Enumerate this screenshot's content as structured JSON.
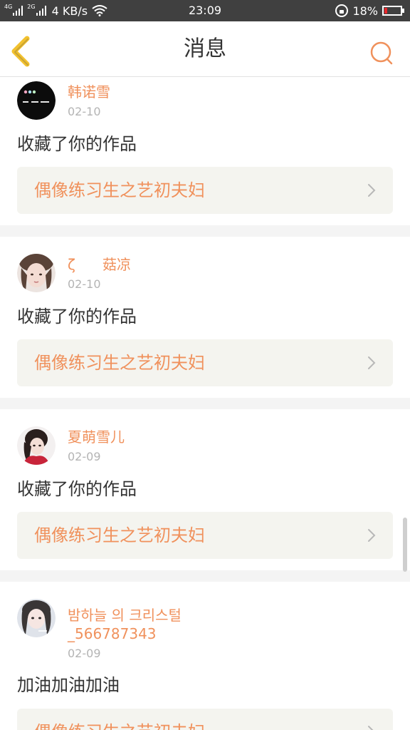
{
  "status_bar": {
    "network_tag_1": "4G",
    "network_tag_2": "2G",
    "speed": "4 KB/s",
    "time": "23:09",
    "battery_percent": "18%",
    "battery_level": 0.18,
    "battery_color": "#e8262b"
  },
  "header": {
    "title": "消息",
    "accent_color": "#f0915c",
    "back_icon": "chevron-left-icon",
    "search_icon": "search-icon"
  },
  "messages": [
    {
      "username": "韩诺雪",
      "date": "02-10",
      "text": "收藏了你的作品",
      "work_title": "偶像练习生之艺初夫妇"
    },
    {
      "username": "ζ      菇凉",
      "date": "02-10",
      "text": "收藏了你的作品",
      "work_title": "偶像练习生之艺初夫妇"
    },
    {
      "username": "夏萌雪儿",
      "date": "02-09",
      "text": "收藏了你的作品",
      "work_title": "偶像练习生之艺初夫妇"
    },
    {
      "username": "밤하늘 의 크리스털",
      "username_line2": "_566787343",
      "date": "02-09",
      "text": "加油加油加油",
      "work_title": "偶像练习生之艺初夫妇"
    }
  ]
}
